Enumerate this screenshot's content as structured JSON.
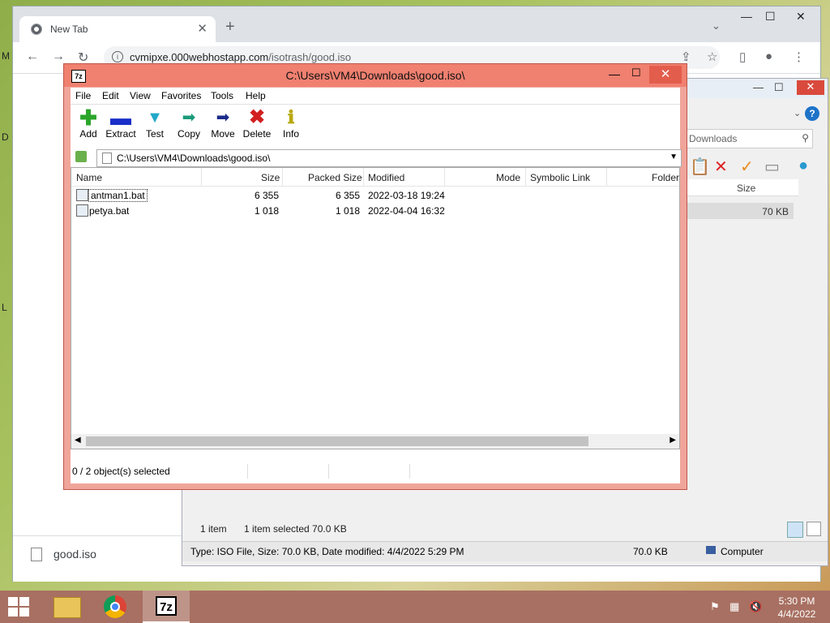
{
  "chrome": {
    "tab_title": "New Tab",
    "url_host": "cvmipxe.000webhostapp.com",
    "url_path": "/isotrash/good.iso",
    "download_name": "good.iso"
  },
  "explorer": {
    "search_placeholder": "Downloads",
    "col_size": "Size",
    "row_size": "70 KB",
    "status_count": "1 item",
    "status_selected": "1 item selected  70.0 KB",
    "details_type": "Type: ISO File, Size: 70.0 KB, Date modified: 4/4/2022 5:29 PM",
    "details_size": "70.0 KB",
    "details_location": "Computer"
  },
  "sevenzip": {
    "title": "C:\\Users\\VM4\\Downloads\\good.iso\\",
    "menu": [
      "File",
      "Edit",
      "View",
      "Favorites",
      "Tools",
      "Help"
    ],
    "tools": [
      {
        "label": "Add",
        "icon": "add-icon",
        "color": "#2aa52a"
      },
      {
        "label": "Extract",
        "icon": "extract-icon",
        "color": "#1a2fc8"
      },
      {
        "label": "Test",
        "icon": "test-icon",
        "color": "#22a8c8"
      },
      {
        "label": "Copy",
        "icon": "copy-icon",
        "color": "#1a9a7a"
      },
      {
        "label": "Move",
        "icon": "move-icon",
        "color": "#1a2a8a"
      },
      {
        "label": "Delete",
        "icon": "delete-icon",
        "color": "#d21f1f"
      },
      {
        "label": "Info",
        "icon": "info-icon",
        "color": "#d8c81a"
      }
    ],
    "path": "C:\\Users\\VM4\\Downloads\\good.iso\\",
    "columns": [
      "Name",
      "Size",
      "Packed Size",
      "Modified",
      "Mode",
      "Symbolic Link",
      "Folder"
    ],
    "files": [
      {
        "name": "antman1.bat",
        "size": "6 355",
        "packed": "6 355",
        "modified": "2022-03-18 19:24"
      },
      {
        "name": "petya.bat",
        "size": "1 018",
        "packed": "1 018",
        "modified": "2022-04-04 16:32"
      }
    ],
    "status": "0 / 2 object(s) selected"
  },
  "taskbar": {
    "time": "5:30 PM",
    "date": "4/4/2022",
    "apps": [
      "file-explorer",
      "chrome",
      "7-zip"
    ]
  }
}
